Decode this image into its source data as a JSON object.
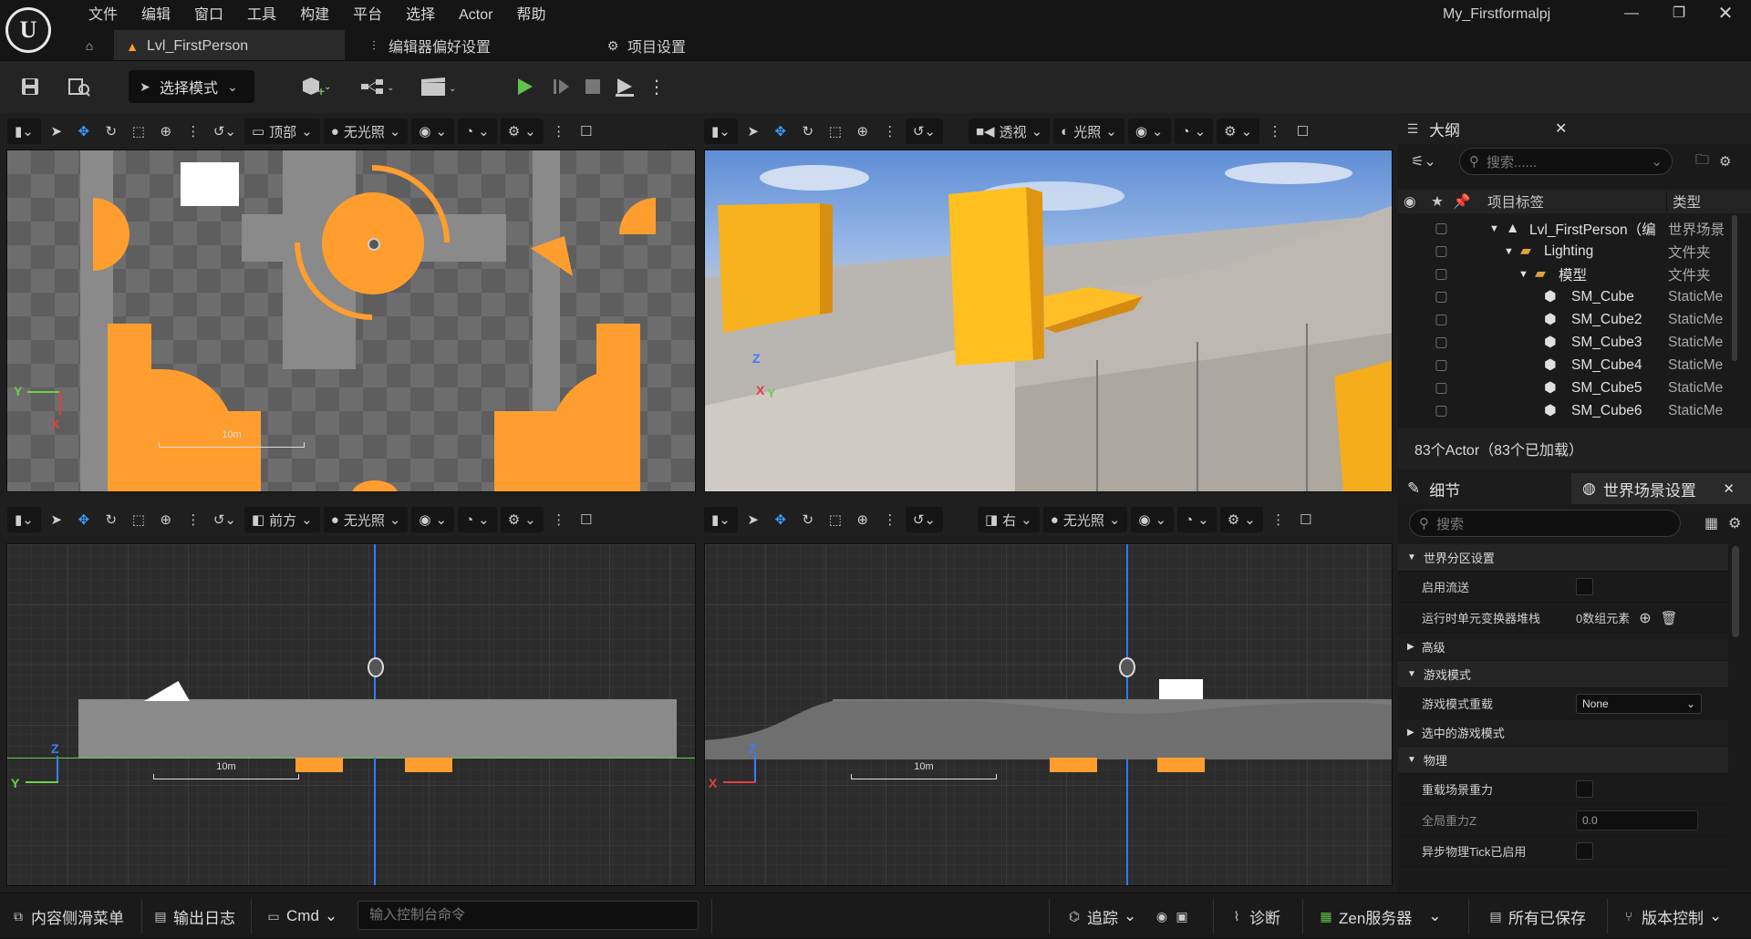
{
  "app": {
    "title": "My_Firstformalpj",
    "menu": [
      "文件",
      "编辑",
      "窗口",
      "工具",
      "构建",
      "平台",
      "选择",
      "Actor",
      "帮助"
    ]
  },
  "tabs": [
    {
      "label": "Lvl_FirstPerson",
      "icon": "level-icon",
      "active": true
    },
    {
      "label": "编辑器偏好设置",
      "icon": "sliders-icon",
      "active": false
    },
    {
      "label": "项目设置",
      "icon": "gears-icon",
      "active": false
    }
  ],
  "toolbar": {
    "select_mode": "选择模式"
  },
  "viewports": [
    {
      "view": "顶部",
      "lighting": "无光照",
      "scale": "10m",
      "axes": [
        "Y",
        "X"
      ]
    },
    {
      "view": "透视",
      "lighting": "光照",
      "axes": [
        "Z",
        "X",
        "Y"
      ]
    },
    {
      "view": "前方",
      "lighting": "无光照",
      "scale": "10m",
      "axes": [
        "Z",
        "Y"
      ]
    },
    {
      "view": "右",
      "lighting": "无光照",
      "scale": "10m",
      "axes": [
        "Z",
        "X"
      ]
    }
  ],
  "outliner": {
    "title": "大纲",
    "search_placeholder": "搜索......",
    "col_label": "项目标签",
    "col_type": "类型",
    "rows": [
      {
        "name": "Lvl_FirstPerson（编",
        "type": "世界场景",
        "indent": 0,
        "icon": "level"
      },
      {
        "name": "Lighting",
        "type": "文件夹",
        "indent": 1,
        "icon": "folder"
      },
      {
        "name": "模型",
        "type": "文件夹",
        "indent": 2,
        "icon": "folder"
      },
      {
        "name": "SM_Cube",
        "type": "StaticMe",
        "indent": 3,
        "icon": "mesh"
      },
      {
        "name": "SM_Cube2",
        "type": "StaticMe",
        "indent": 3,
        "icon": "mesh"
      },
      {
        "name": "SM_Cube3",
        "type": "StaticMe",
        "indent": 3,
        "icon": "mesh"
      },
      {
        "name": "SM_Cube4",
        "type": "StaticMe",
        "indent": 3,
        "icon": "mesh"
      },
      {
        "name": "SM_Cube5",
        "type": "StaticMe",
        "indent": 3,
        "icon": "mesh"
      },
      {
        "name": "SM_Cube6",
        "type": "StaticMe",
        "indent": 3,
        "icon": "mesh"
      }
    ],
    "footer": "83个Actor（83个已加载）"
  },
  "details": {
    "tab1": "细节",
    "tab2": "世界场景设置",
    "search_placeholder": "搜索",
    "sections": {
      "world_partition": "世界分区设置",
      "advanced": "高级",
      "game_mode": "游戏模式",
      "selected_game_mode": "选中的游戏模式",
      "physics": "物理"
    },
    "props": {
      "enable_streaming": "启用流送",
      "runtime_cell_stack": "运行时单元变换器堆栈",
      "array_value": "0数组元素",
      "game_mode_override": "游戏模式重载",
      "game_mode_value": "None",
      "override_gravity": "重载场景重力",
      "global_gravity": "全局重力Z",
      "global_gravity_value": "0.0",
      "async_physics": "异步物理Tick已启用"
    }
  },
  "statusbar": {
    "content_drawer": "内容侧滑菜单",
    "output_log": "输出日志",
    "cmd": "Cmd",
    "cmd_placeholder": "输入控制台命令",
    "trace": "追踪",
    "diagnostics": "诊断",
    "zen": "Zen服务器",
    "saved": "所有已保存",
    "vcs": "版本控制"
  },
  "colors": {
    "accent_orange": "#ff9e2e",
    "play_green": "#5fc24a",
    "background": "#151515"
  }
}
